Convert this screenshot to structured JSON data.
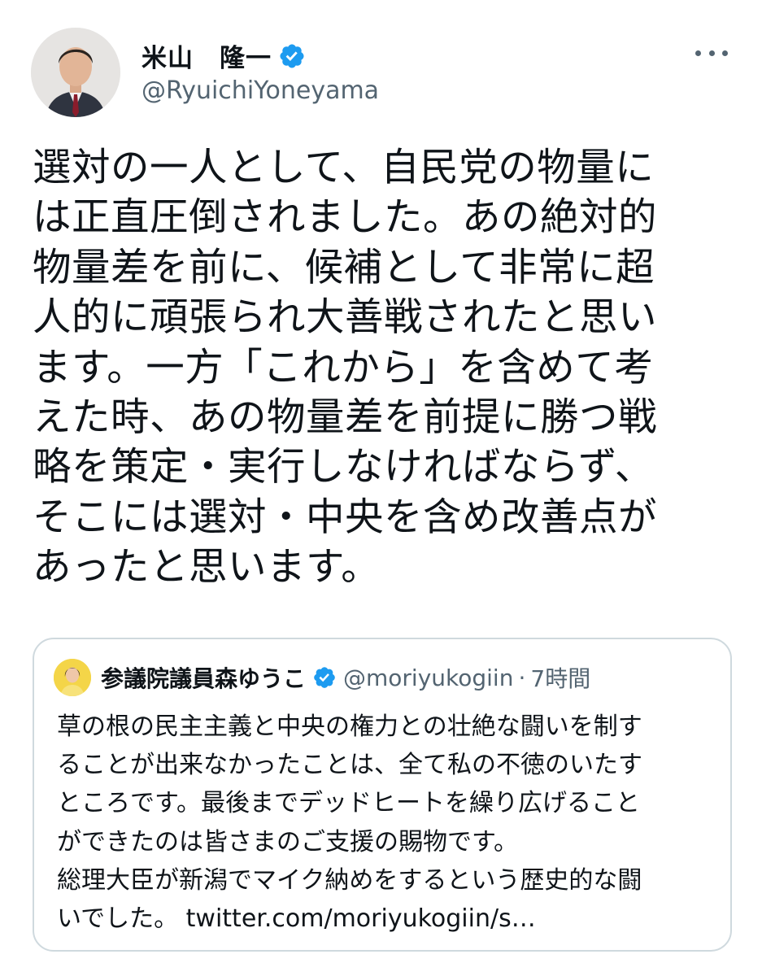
{
  "author": {
    "display_name": "米山　隆一",
    "handle": "@RyuichiYoneyama",
    "verified": true,
    "avatar": "avatar-photo"
  },
  "tweet": {
    "lines": [
      "選対の一人として、自民党の物量に",
      "は正直圧倒されました。あの絶対的",
      "物量差を前に、候補として非常に超",
      "人的に頑張られ大善戦されたと思い",
      "ます。一方「これから」を含めて考",
      "えた時、あの物量差を前提に勝つ戦",
      "略を策定・実行しなければならず、",
      "そこには選対・中央を含め改善点が",
      "あったと思います。"
    ]
  },
  "quote": {
    "display_name": "参議院議員森ゆうこ",
    "handle": "@moriyukogiin",
    "separator": "·",
    "time": "7時間",
    "lines": [
      "草の根の民主主義と中央の権力との壮絶な闘いを制す",
      "ることが出来なかったことは、全て私の不徳のいたす",
      "ところです。最後までデッドヒートを繰り広げること",
      "ができたのは皆さまのご支援の賜物です。",
      "総理大臣が新潟でマイク納めをするという歴史的な闘"
    ],
    "last_line_text": "いでした。",
    "link": "twitter.com/moriyukogiin/s…"
  },
  "colors": {
    "verified_blue": "#1d9bf0",
    "secondary_text": "#536471",
    "border": "#cfd9de"
  },
  "icons": {
    "more": "more-horizontal-icon",
    "verified": "verified-badge-icon"
  }
}
